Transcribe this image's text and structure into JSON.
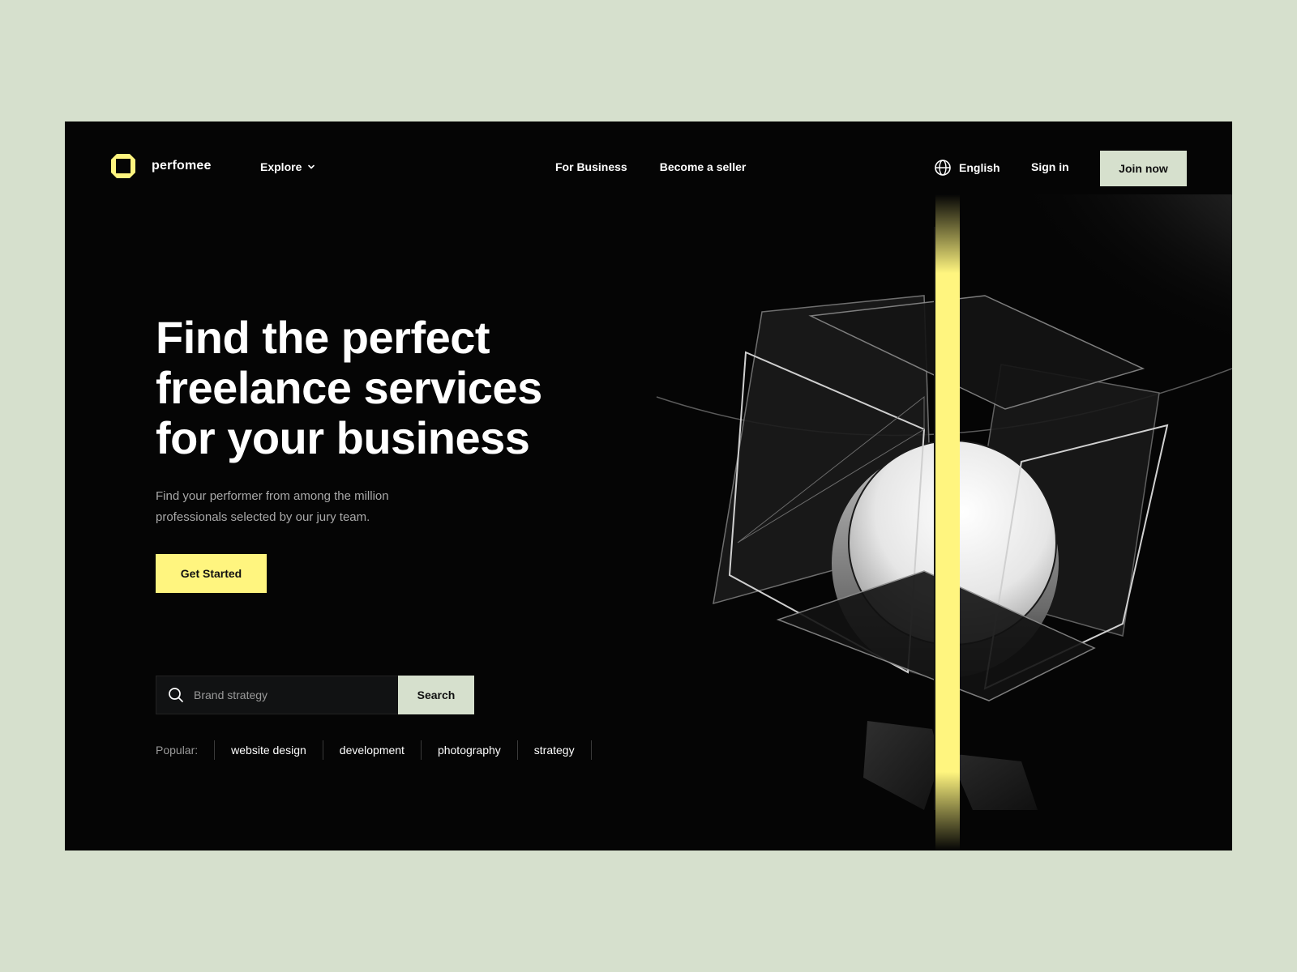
{
  "brand": {
    "name": "perfomee",
    "accent": "#fff57f",
    "surface": "#d6e0cd",
    "background": "#050505"
  },
  "nav": {
    "explore": "Explore",
    "for_business": "For Business",
    "become_seller": "Become a seller",
    "language": "English",
    "sign_in": "Sign in",
    "join": "Join now"
  },
  "hero": {
    "title_lines": [
      "Find the perfect",
      "freelance services",
      "for your business"
    ],
    "subtitle": "Find your performer from among the million professionals selected by our jury team.",
    "cta": "Get Started"
  },
  "search": {
    "placeholder": "Brand strategy",
    "button": "Search"
  },
  "popular": {
    "label": "Popular:",
    "tags": [
      "website design",
      "development",
      "photography",
      "strategy"
    ]
  },
  "icons": [
    "logo-mark-icon",
    "chevron-down-icon",
    "globe-icon",
    "search-icon"
  ]
}
